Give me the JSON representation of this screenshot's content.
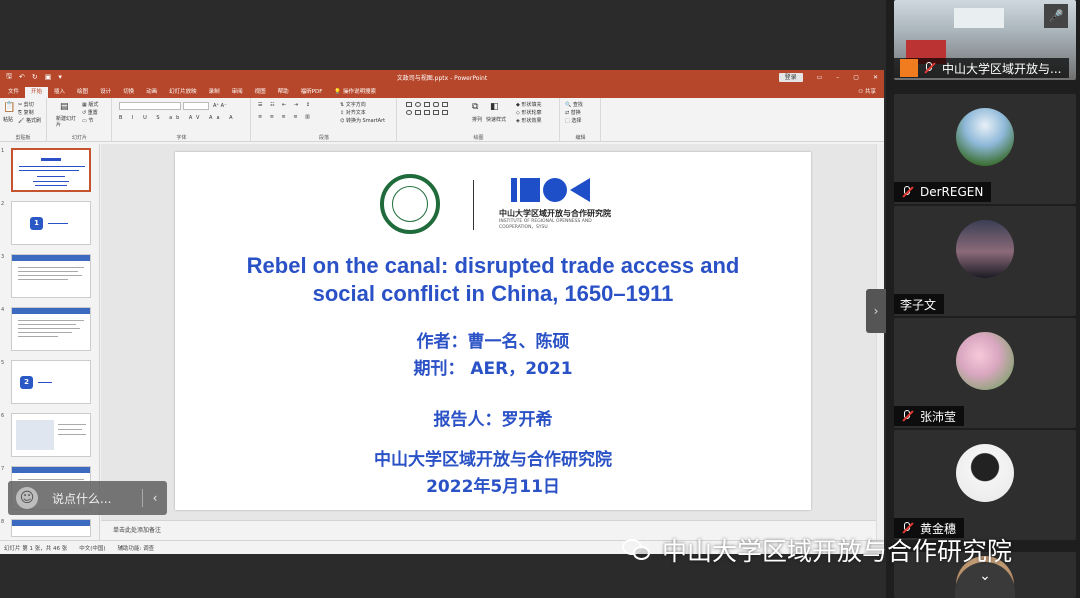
{
  "ppt": {
    "doc_title": "文政司与视图.pptx - PowerPoint",
    "login": "登录",
    "tabs": [
      "文件",
      "开始",
      "插入",
      "绘图",
      "设计",
      "切换",
      "动画",
      "幻灯片放映",
      "录制",
      "审阅",
      "视图",
      "帮助",
      "福昕PDF",
      "操作说明搜索"
    ],
    "share": "共享",
    "ribbon": {
      "paste": "粘贴",
      "cut": "剪切",
      "copy": "复制",
      "format_painter": "格式刷",
      "clipboard": "剪贴板",
      "new_slide": "新建幻灯片",
      "layout": "版式",
      "reset": "重置",
      "section": "节",
      "slides": "幻灯片",
      "font": "字体",
      "text_direction": "文字方向",
      "align_text": "对齐文本",
      "smartart": "转换为 SmartArt",
      "paragraph": "段落",
      "arrange": "排列",
      "quick_styles": "快速样式",
      "shape_fill": "形状填充",
      "shape_outline": "形状轮廓",
      "shape_effects": "形状效果",
      "drawing": "绘图",
      "find": "查找",
      "replace": "替换",
      "select": "选择",
      "editing": "编辑"
    },
    "thumb_numbers": [
      "1",
      "2",
      "3",
      "4",
      "5",
      "6",
      "7",
      "8"
    ],
    "thumb_hex": [
      "1",
      "2"
    ],
    "notes_placeholder": "单击此处添加备注",
    "status": [
      "幻灯片 第 1 张，共 46 张",
      "中文(中国)",
      "辅助功能: 调查"
    ]
  },
  "slide": {
    "title_line1": "Rebel on the canal: disrupted trade access and",
    "title_line2": "social conflict in China, 1650–1911",
    "author": "作者：曹一名、陈硕",
    "journal": "期刊： AER，2021",
    "reporter": "报告人：罗开希",
    "institute": "中山大学区域开放与合作研究院",
    "date": "2022年5月11日",
    "logo_institute_cn": "中山大学区域开放与合作研究院",
    "logo_institute_en": "INSTITUTE OF REGIONAL OPENNESS AND COOPERATION，SYSU"
  },
  "chat": {
    "placeholder": "说点什么...",
    "emoji_icon": "smile-icon"
  },
  "participants": [
    {
      "name": "中山大学区域开放与..."
    },
    {
      "name": "DerREGEN"
    },
    {
      "name": "李子文"
    },
    {
      "name": "张沛莹"
    },
    {
      "name": "黄金穗"
    }
  ],
  "watermark": "中山大学区域开放与合作研究院",
  "colors": {
    "ppt_accent": "#b7472a",
    "slide_blue": "#2a52c6",
    "muted_red": "#e53935"
  }
}
